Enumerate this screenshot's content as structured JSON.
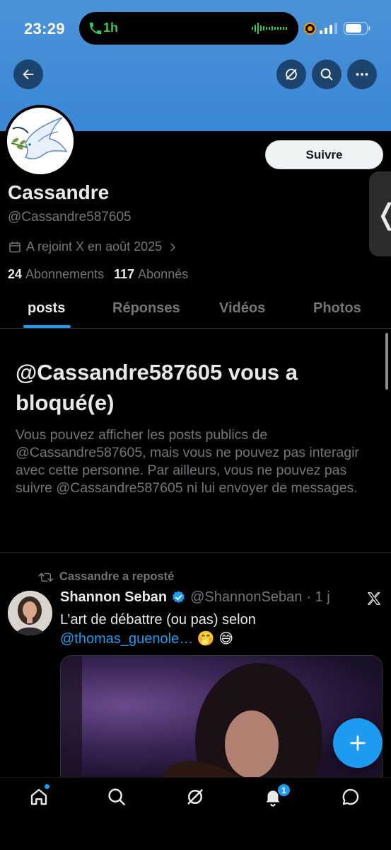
{
  "status_bar": {
    "time": "23:29",
    "call_duration": "1h"
  },
  "profile": {
    "follow_label": "Suivre",
    "display_name": "Cassandre",
    "handle": "@Cassandre587605",
    "joined": "A rejoint X en août 2025",
    "following_count": "24",
    "following_label": "Abonnements",
    "followers_count": "117",
    "followers_label": "Abonnés"
  },
  "tabs": [
    {
      "label": "posts",
      "active": true
    },
    {
      "label": "Réponses",
      "active": false
    },
    {
      "label": "Vidéos",
      "active": false
    },
    {
      "label": "Photos",
      "active": false
    }
  ],
  "blocked": {
    "title": "@Cassandre587605 vous a bloqué(e)",
    "body": "Vous pouvez afficher les posts publics de @Cassandre587605, mais vous ne pouvez pas interagir avec cette personne. Par ailleurs, vous ne pouvez pas suivre @Cassandre587605 ni lui envoyer de messages."
  },
  "post": {
    "repost_label": "Cassandre a reposté",
    "author_name": "Shannon Seban",
    "author_handle": "@ShannonSeban",
    "time": "· 1 j",
    "text_before": "L’art de débattre (ou pas) selon",
    "mention": "@thomas_guenole…",
    "emoji": " 🤭 😅"
  },
  "nav": {
    "notifications_badge": "1"
  },
  "colors": {
    "accent": "#1d9bf0",
    "banner": "#3b86d6",
    "background": "#000000",
    "muted_text": "#71767b"
  },
  "icons": [
    "back-arrow-icon",
    "grok-icon",
    "search-icon",
    "more-icon",
    "calendar-icon",
    "chevron-right-icon",
    "repost-icon",
    "verified-badge-icon",
    "x-logo-icon",
    "plus-icon",
    "home-icon",
    "explore-icon",
    "grok-nav-icon",
    "notifications-icon",
    "messages-icon"
  ]
}
